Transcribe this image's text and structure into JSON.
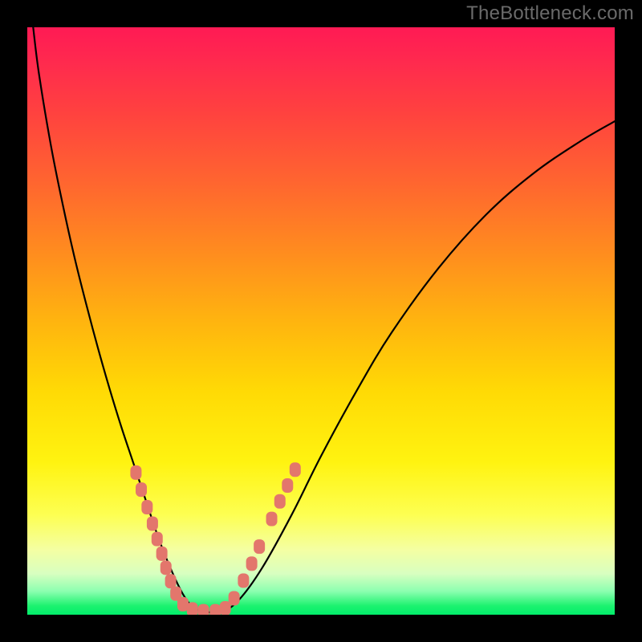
{
  "watermark": "TheBottleneck.com",
  "chart_data": {
    "type": "line",
    "title": "",
    "xlabel": "",
    "ylabel": "",
    "xlim": [
      0,
      100
    ],
    "ylim": [
      0,
      100
    ],
    "grid": false,
    "legend": false,
    "series": [
      {
        "name": "bottleneck-curve",
        "x": [
          1,
          2,
          4,
          6,
          8,
          10,
          12,
          14,
          16,
          18,
          20,
          22,
          23.5,
          25,
          26.5,
          28,
          30,
          33,
          36,
          40,
          45,
          50,
          56,
          62,
          70,
          78,
          86,
          94,
          100
        ],
        "y": [
          100,
          92,
          80,
          70,
          61,
          53,
          45.5,
          38.5,
          32,
          26,
          20,
          14,
          10,
          6.5,
          3.5,
          1.5,
          0.6,
          0.5,
          2.5,
          8,
          17,
          27,
          38,
          48,
          59,
          68,
          75,
          80.5,
          84
        ]
      }
    ],
    "markers": {
      "name": "highlight-beads",
      "color": "#e3766c",
      "points": [
        {
          "x": 18.5,
          "y": 24.2
        },
        {
          "x": 19.4,
          "y": 21.3
        },
        {
          "x": 20.4,
          "y": 18.3
        },
        {
          "x": 21.3,
          "y": 15.5
        },
        {
          "x": 22.1,
          "y": 12.9
        },
        {
          "x": 22.9,
          "y": 10.4
        },
        {
          "x": 23.6,
          "y": 8.0
        },
        {
          "x": 24.4,
          "y": 5.7
        },
        {
          "x": 25.3,
          "y": 3.6
        },
        {
          "x": 26.5,
          "y": 1.8
        },
        {
          "x": 28.1,
          "y": 0.9
        },
        {
          "x": 30.0,
          "y": 0.6
        },
        {
          "x": 32.0,
          "y": 0.6
        },
        {
          "x": 33.7,
          "y": 1.1
        },
        {
          "x": 35.2,
          "y": 2.8
        },
        {
          "x": 36.8,
          "y": 5.8
        },
        {
          "x": 38.2,
          "y": 8.7
        },
        {
          "x": 39.5,
          "y": 11.6
        },
        {
          "x": 41.6,
          "y": 16.3
        },
        {
          "x": 43.0,
          "y": 19.3
        },
        {
          "x": 44.3,
          "y": 22.0
        },
        {
          "x": 45.6,
          "y": 24.7
        }
      ]
    },
    "background_gradient": {
      "direction": "vertical",
      "stops": [
        {
          "pos": 0.0,
          "color": "#ff1a54"
        },
        {
          "pos": 0.5,
          "color": "#ffb40f"
        },
        {
          "pos": 0.83,
          "color": "#fdff52"
        },
        {
          "pos": 0.96,
          "color": "#8cffb0"
        },
        {
          "pos": 1.0,
          "color": "#02ed6b"
        }
      ]
    }
  }
}
